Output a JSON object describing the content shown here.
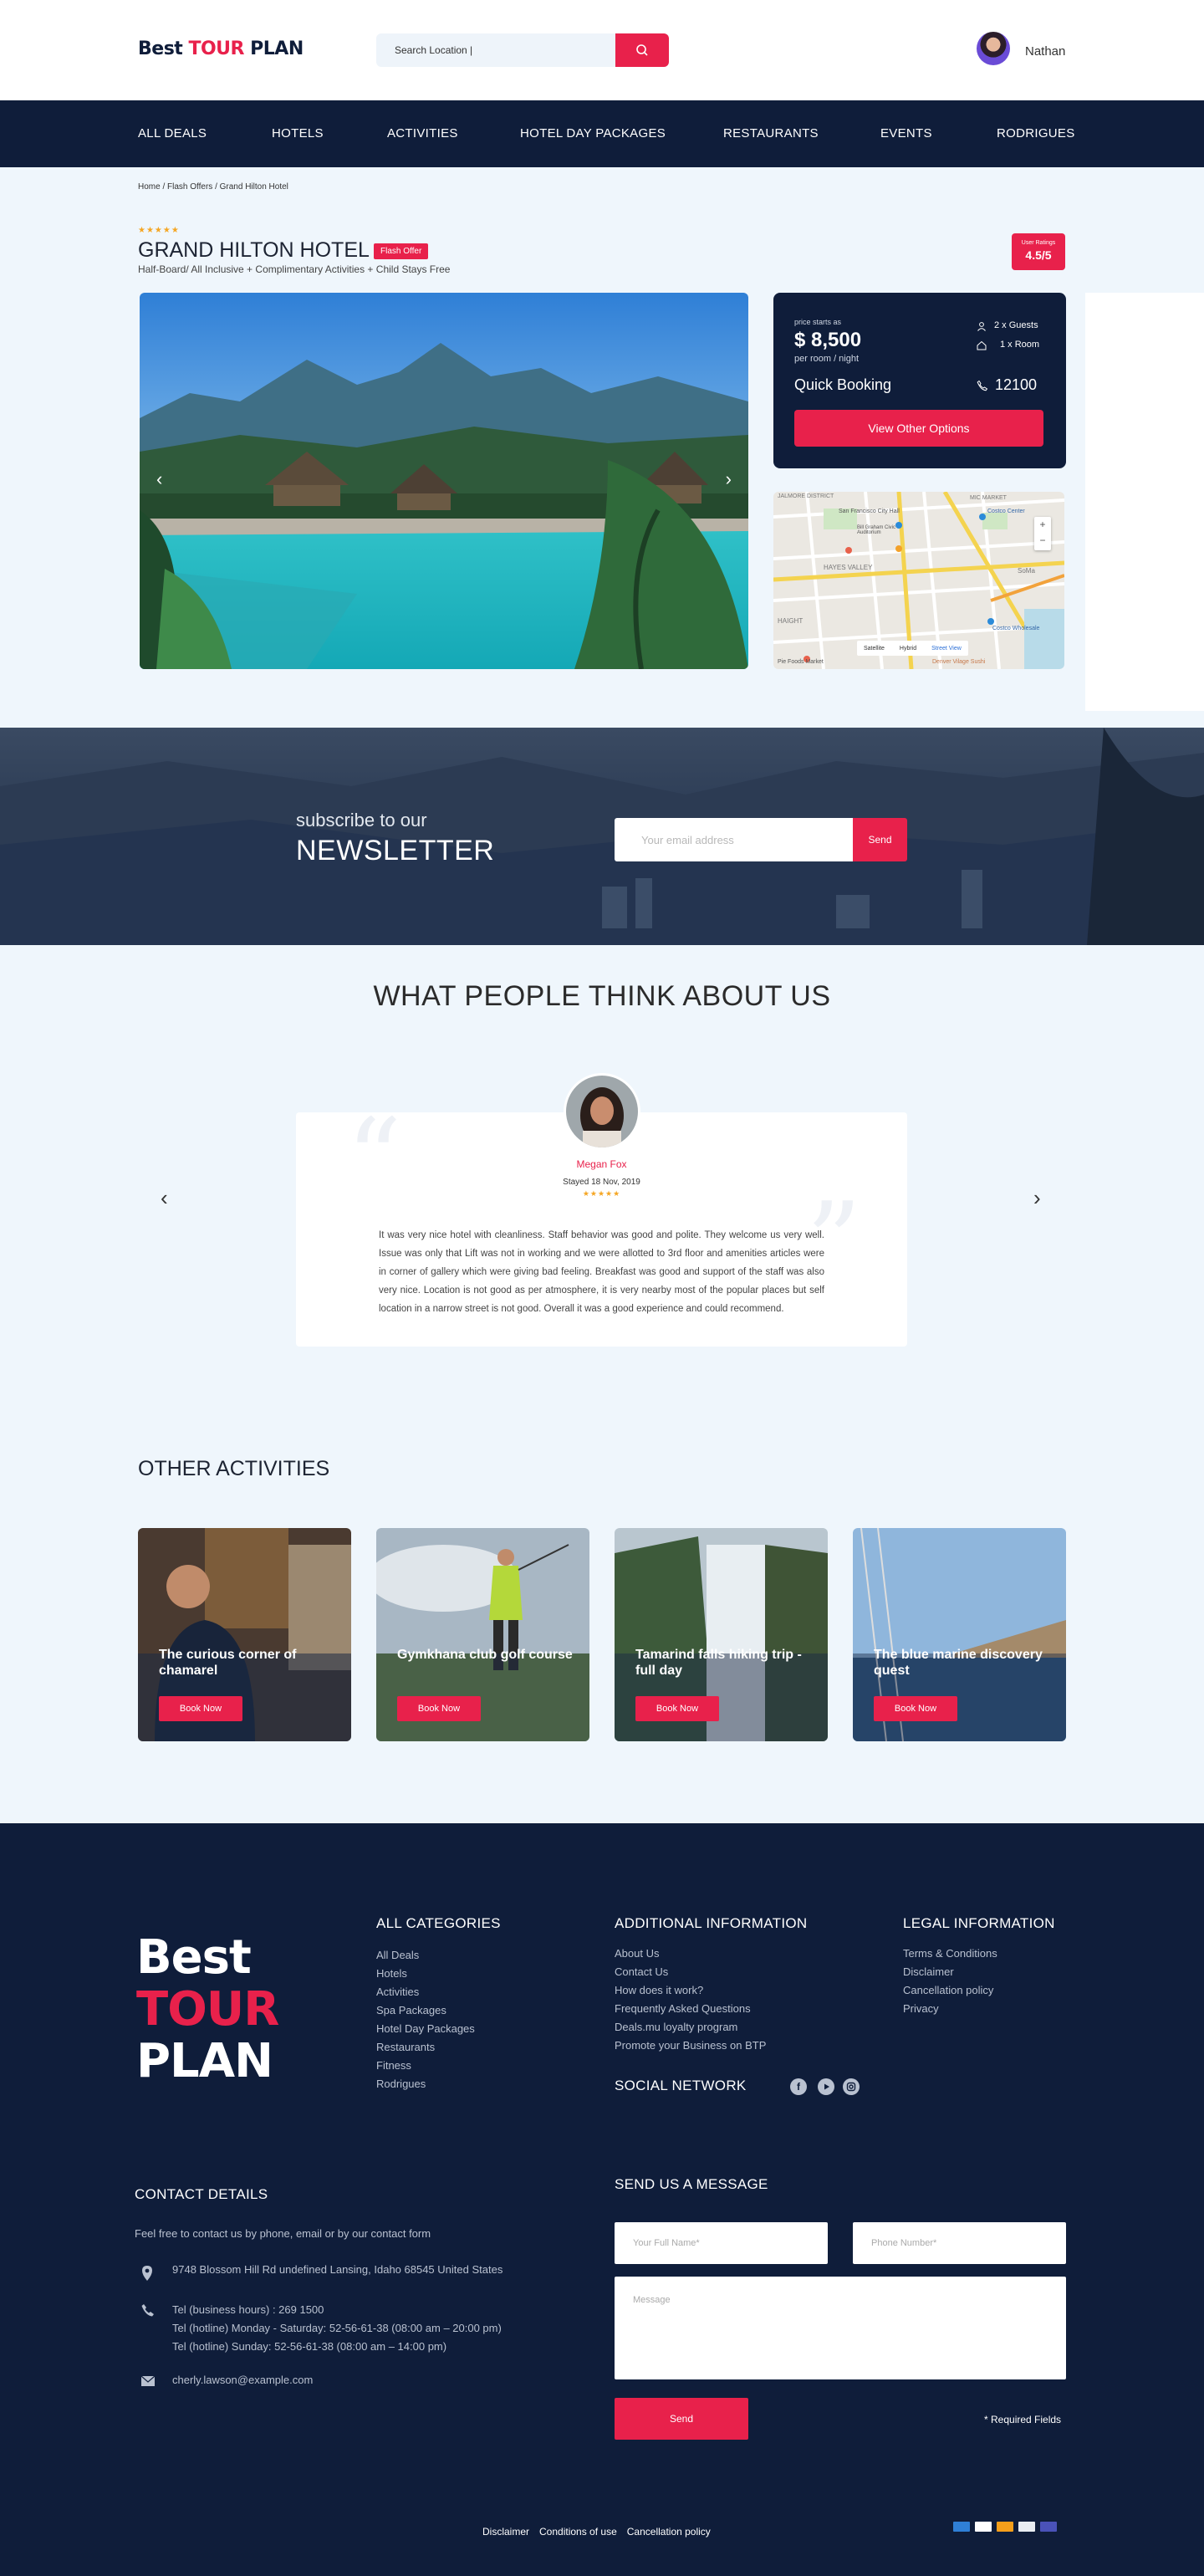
{
  "header": {
    "logo": {
      "part1": "Best ",
      "part2": "TOUR",
      "part3": " PLAN"
    },
    "search": {
      "value": "Search Location |"
    },
    "user_name": "Nathan"
  },
  "nav": [
    "ALL DEALS",
    "HOTELS",
    "ACTIVITIES",
    "HOTEL DAY PACKAGES",
    "RESTAURANTS",
    "EVENTS",
    "RODRIGUES"
  ],
  "hotel": {
    "breadcrumb": "Home / Flash Offers / Grand Hilton Hotel",
    "stars": "★★★★★",
    "title": "GRAND HILTON HOTEL",
    "badge": "Flash Offer",
    "subtitle": "Half-Board/ All Inclusive + Complimentary Activities + Child Stays Free",
    "rating_label": "User Ratings",
    "rating_value": "4.5/5"
  },
  "booking": {
    "price_label": "price starts as",
    "price": "$ 8,500",
    "price_unit": "per room / night",
    "guests": "2 x Guests",
    "rooms": "1 x Room",
    "quick_booking": "Quick Booking",
    "phone": "12100",
    "options_button": "View Other Options"
  },
  "map": {
    "labels": [
      "JALMORE DISTRICT",
      "MIC MARKET",
      "San Francisco City Hall",
      "Bill Graham Civic Auditorium",
      "Costco Center",
      "HAYES VALLEY",
      "SoMa",
      "HAIGHT",
      "Costco Wholesale",
      "Pie Foods Market",
      "Denver Vilage Sushi"
    ],
    "controls": [
      "+",
      "−"
    ],
    "toggles": [
      "Satellite",
      "Hybrid",
      "Street View"
    ]
  },
  "newsletter": {
    "line1": "subscribe to our",
    "line2": "NEWSLETTER",
    "placeholder": "Your email address",
    "button": "Send"
  },
  "testimonials": {
    "title": "WHAT PEOPLE THINK ABOUT US",
    "name": "Megan Fox",
    "stayed": "Stayed 18 Nov, 2019",
    "stars": "★★★★★",
    "text": "It was very nice hotel with cleanliness. Staff behavior was good and polite. They welcome us very well. Issue was only that Lift was not in working and we were allotted to 3rd floor and amenities articles were in corner of gallery which were giving bad feeling. Breakfast was good and support of the staff was also very nice. Location is not good as per atmosphere, it is very nearby most of the popular places but self location in a narrow street is not good. Overall it was a good experience and could recommend."
  },
  "activities": {
    "title": "OTHER ACTIVITIES",
    "items": [
      {
        "name": "The curious corner of chamarel",
        "button": "Book Now"
      },
      {
        "name": "Gymkhana club golf course",
        "button": "Book Now"
      },
      {
        "name": "Tamarind falls hiking trip - full day",
        "button": "Book Now"
      },
      {
        "name": "The blue marine discovery quest",
        "button": "Book Now"
      }
    ]
  },
  "footer": {
    "logo": {
      "word1": "Best",
      "word2": "TOUR",
      "word3": "PLAN"
    },
    "categories": {
      "title": "ALL CATEGORIES",
      "items": [
        "All Deals",
        "Hotels",
        "Activities",
        "Spa Packages",
        "Hotel Day Packages",
        "Restaurants",
        "Fitness",
        "Rodrigues"
      ]
    },
    "additional": {
      "title": "ADDITIONAL INFORMATION",
      "items": [
        "About Us",
        "Contact Us",
        "How does it work?",
        "Frequently Asked Questions",
        "Deals.mu loyalty program",
        "Promote your Business on BTP"
      ]
    },
    "legal": {
      "title": "LEGAL INFORMATION",
      "items": [
        "Terms & Conditions",
        "Disclaimer",
        "Cancellation policy",
        "Privacy"
      ]
    },
    "social_title": "SOCIAL NETWORK",
    "contact": {
      "title": "CONTACT DETAILS",
      "intro": "Feel free to contact us by phone, email or by our contact form",
      "address": "9748 Blossom Hill Rd undefined Lansing, Idaho 68545 United States",
      "phone1": "Tel (business hours) : 269 1500",
      "phone2": "Tel (hotline) Monday - Saturday: 52-56-61-38 (08:00 am – 20:00 pm)",
      "phone3": "Tel (hotline) Sunday: 52-56-61-38 (08:00 am – 14:00 pm)",
      "email": "cherly.lawson@example.com"
    },
    "message": {
      "title": "SEND US A MESSAGE",
      "name_placeholder": "Your Full Name*",
      "phone_placeholder": "Phone Number*",
      "message_placeholder": "Message",
      "send": "Send",
      "required": "* Required Fields"
    },
    "bottom_links": [
      "Disclaimer",
      "Conditions of use",
      "Cancellation policy"
    ]
  },
  "colors": {
    "navy": "#0f1d3a",
    "accent": "#e8214b",
    "background": "#eff6fc"
  }
}
